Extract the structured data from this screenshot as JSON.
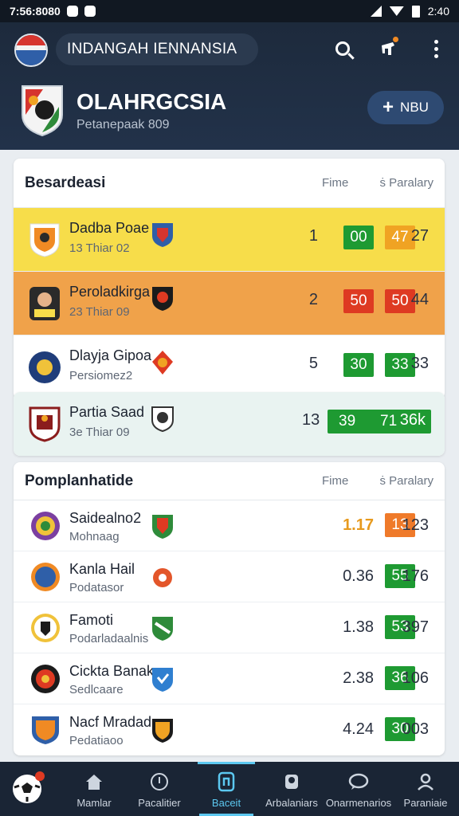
{
  "status_bar": {
    "time": "7:56:8080",
    "clock_right": "2:40"
  },
  "header": {
    "search_text": "INDANGAH IENNANSIA",
    "club_title": "OLAHRGCSIA",
    "club_subtitle": "Petanepaak 809",
    "add_button_label": "NBU",
    "icons": [
      "search-icon",
      "bell-icon",
      "more-vert-icon"
    ]
  },
  "standings": {
    "title": "Besardeasi",
    "col1": "Fime",
    "col2": "ṡ Paralary",
    "rows": [
      {
        "name": "Dadba Poae",
        "sub": "13 Thiar 02",
        "pos": "1",
        "v1": "00",
        "v2": "47",
        "last": "27",
        "highlight": "yellow"
      },
      {
        "name": "Peroladkirga",
        "sub": "23 Thiar 09",
        "pos": "2",
        "v1": "50",
        "v2": "50",
        "last": "44",
        "highlight": "orange"
      },
      {
        "name": "Dlayja Gipoa",
        "sub": "Persiomez2",
        "pos": "5",
        "v1": "30",
        "v2": "33",
        "last": "33",
        "highlight": "none"
      }
    ]
  },
  "featured": {
    "name": "Partia Saad",
    "sub": "3e Thiar 09",
    "pos": "13",
    "v1": "39",
    "v2": "71",
    "last": "36k"
  },
  "predictions": {
    "title": "Pomplanhatide",
    "col1": "Fime",
    "col2": "ṡ Paralary",
    "rows": [
      {
        "name": "Saidealno2",
        "sub": "Mohnaag",
        "odd": "1.17",
        "badge": "13",
        "badge_color": "orange",
        "last": "123"
      },
      {
        "name": "Kanla Hail",
        "sub": "Podatasor",
        "odd": "0.36",
        "badge": "55",
        "badge_color": "green",
        "last": "176"
      },
      {
        "name": "Famoti",
        "sub": "Podarladaalnis",
        "odd": "1.38",
        "badge": "53",
        "badge_color": "green",
        "last": "397"
      },
      {
        "name": "Cickta Banak",
        "sub": "Sedlcaare",
        "odd": "2.38",
        "badge": "36",
        "badge_color": "green",
        "last": "106"
      },
      {
        "name": "Nacf Mradad",
        "sub": "Pedatiaoo",
        "odd": "4.24",
        "badge": "30",
        "badge_color": "green",
        "last": "003"
      }
    ]
  },
  "nav": {
    "items": [
      {
        "label": "Mamlar",
        "icon": "home-icon"
      },
      {
        "label": "Pacalitier",
        "icon": "clock-icon"
      },
      {
        "label": "Baceit",
        "icon": "card-icon"
      },
      {
        "label": "Arbalaniars",
        "icon": "person-badge-icon"
      },
      {
        "label": "Onarmenarios",
        "icon": "chat-icon"
      },
      {
        "label": "Paraniaie",
        "icon": "user-icon"
      }
    ],
    "active_index": 2
  },
  "colors": {
    "header": "#1d2a3c",
    "green": "#1e9a32",
    "red": "#de3a22",
    "amber": "#f0a323",
    "accent": "#5cc8f0"
  }
}
